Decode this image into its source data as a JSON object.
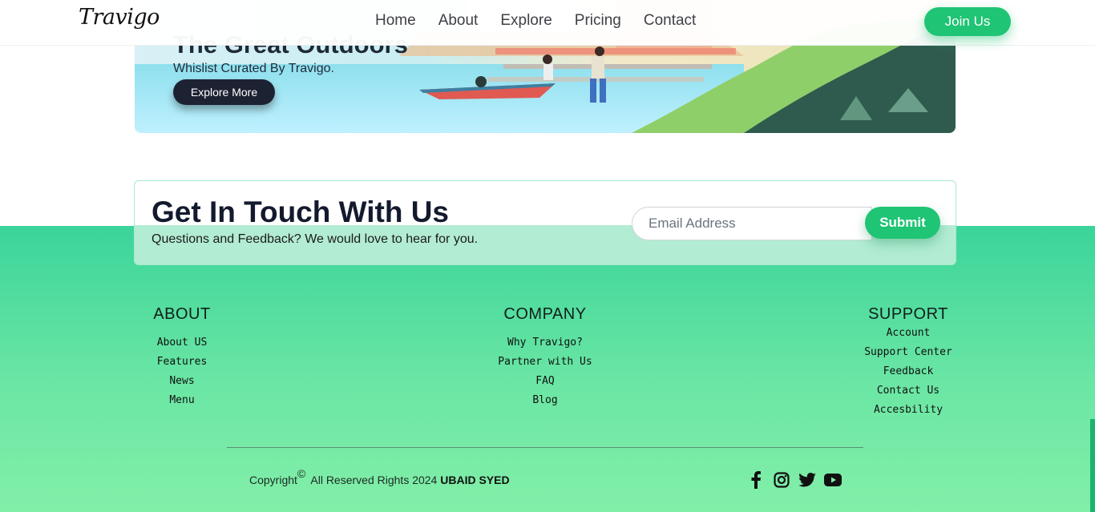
{
  "header": {
    "logo": "Travigo",
    "nav": [
      "Home",
      "About",
      "Explore",
      "Pricing",
      "Contact"
    ],
    "join_label": "Join Us"
  },
  "banner": {
    "title": "The Great Outdoors",
    "subtitle": "Whislist Curated By Travigo.",
    "button_label": "Explore More"
  },
  "contact": {
    "title": "Get In Touch With Us",
    "subtitle": "Questions and Feedback? We would love to hear for you.",
    "email_placeholder": "Email Address",
    "submit_label": "Submit"
  },
  "footer": {
    "about": {
      "heading": "ABOUT",
      "links": [
        "About US",
        "Features",
        "News",
        "Menu"
      ]
    },
    "company": {
      "heading": "COMPANY",
      "links": [
        "Why Travigo?",
        "Partner with Us",
        "FAQ",
        "Blog"
      ]
    },
    "support": {
      "heading": "SUPPORT",
      "links": [
        "Account",
        "Support Center",
        "Feedback",
        "Contact Us",
        "Accesbility"
      ]
    },
    "copyright_prefix": "Copyright",
    "copyright_symbol": "©",
    "copyright_text": "All Reserved Rights 2024",
    "author": "UBAID SYED",
    "social_icons": [
      "facebook-icon",
      "instagram-icon",
      "twitter-icon",
      "youtube-icon"
    ]
  },
  "colors": {
    "accent": "#1fc474",
    "dark_button": "#1d2233",
    "footer_top": "#3bd49a",
    "footer_bottom": "#82efa8"
  }
}
